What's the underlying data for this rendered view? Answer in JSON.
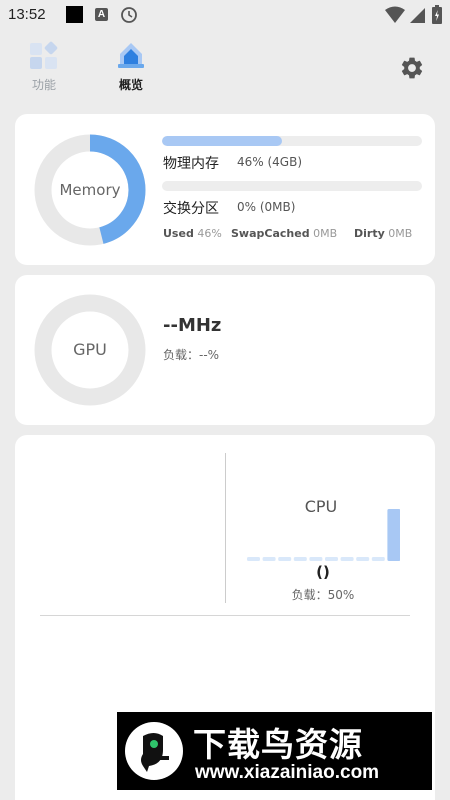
{
  "status_bar": {
    "time": "13:52",
    "app_letter": "A"
  },
  "nav": {
    "items": [
      {
        "label": "功能",
        "icon": "grid-diamond-icon",
        "active": false
      },
      {
        "label": "概览",
        "icon": "home-icon",
        "active": true
      }
    ],
    "settings_icon": "gear-icon"
  },
  "memory": {
    "ring_label": "Memory",
    "ring_percent": 46,
    "rows": [
      {
        "name": "物理内存",
        "value": "46% (4GB)",
        "percent": 46
      },
      {
        "name": "交换分区",
        "value": "0% (0MB)",
        "percent": 0
      }
    ],
    "stats": [
      {
        "label": "Used",
        "value": "46%"
      },
      {
        "label": "SwapCached",
        "value": "0MB"
      },
      {
        "label": "Dirty",
        "value": "0MB"
      }
    ]
  },
  "gpu": {
    "ring_label": "GPU",
    "frequency": "--MHz",
    "load": "负载：--%"
  },
  "cpu": {
    "title": "CPU",
    "name": "()",
    "load": "负载：50%",
    "bars": [
      0,
      0,
      0,
      0,
      0,
      0,
      0,
      0,
      0,
      1
    ]
  },
  "watermark": {
    "title": "下载鸟资源",
    "url": "www.xiazainiao.com"
  },
  "colors": {
    "accent": "#6aa8ec",
    "accent_light": "#a8c8f4",
    "ring_track": "#e8e8e8",
    "card": "#ffffff",
    "background": "#ececec"
  }
}
